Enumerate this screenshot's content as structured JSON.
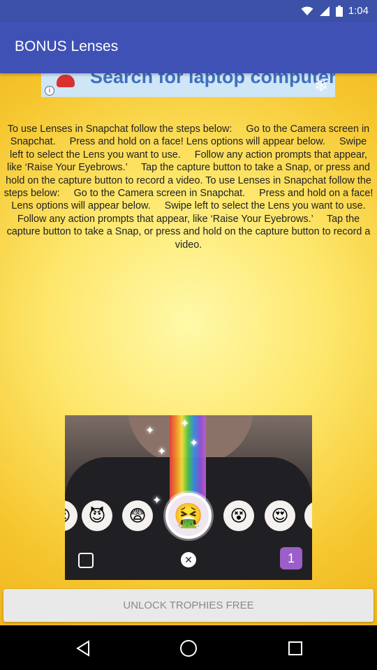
{
  "status_bar": {
    "time": "1:04",
    "icons": [
      "wifi-icon",
      "signal-icon",
      "battery-icon"
    ]
  },
  "app_bar": {
    "title": "BONUS Lenses"
  },
  "ad": {
    "text": "Search for laptop computers",
    "info_glyph": "i"
  },
  "instructions": "To use Lenses in Snapchat follow the steps below:     Go to the Camera screen in Snapchat.     Press and hold on a face! Lens options will appear below.     Swipe left to select the Lens you want to use.     Follow any action prompts that appear, like ‘Raise Your Eyebrows.’     Tap the capture button to take a Snap, or press and hold on the capture button to record a video. To use Lenses in Snapchat follow the steps below:     Go to the Camera screen in Snapchat.     Press and hold on a face! Lens options will appear below.     Swipe left to select the Lens you want to use.     Follow any action prompts that appear, like ‘Raise Your Eyebrows.’     Tap the capture button to take a Snap, or press and hold on the capture button to record a video.",
  "preview": {
    "lenses": [
      {
        "emoji": "😡"
      },
      {
        "emoji": "😈"
      },
      {
        "emoji": "😨"
      },
      {
        "emoji": "🤮"
      },
      {
        "emoji": "😵"
      },
      {
        "emoji": "😍"
      },
      {
        "emoji": "😄"
      }
    ],
    "count_badge": "1",
    "close_glyph": "✕"
  },
  "unlock_button": {
    "label": "UNLOCK TROPHIES FREE"
  },
  "nav": {
    "items": [
      "back-icon",
      "home-icon",
      "recents-icon"
    ]
  },
  "colors": {
    "app_bar": "#3f51b5",
    "status_bar": "#3b52a8",
    "background_yellow": "#fde66a",
    "badge": "#9a5fc8"
  }
}
